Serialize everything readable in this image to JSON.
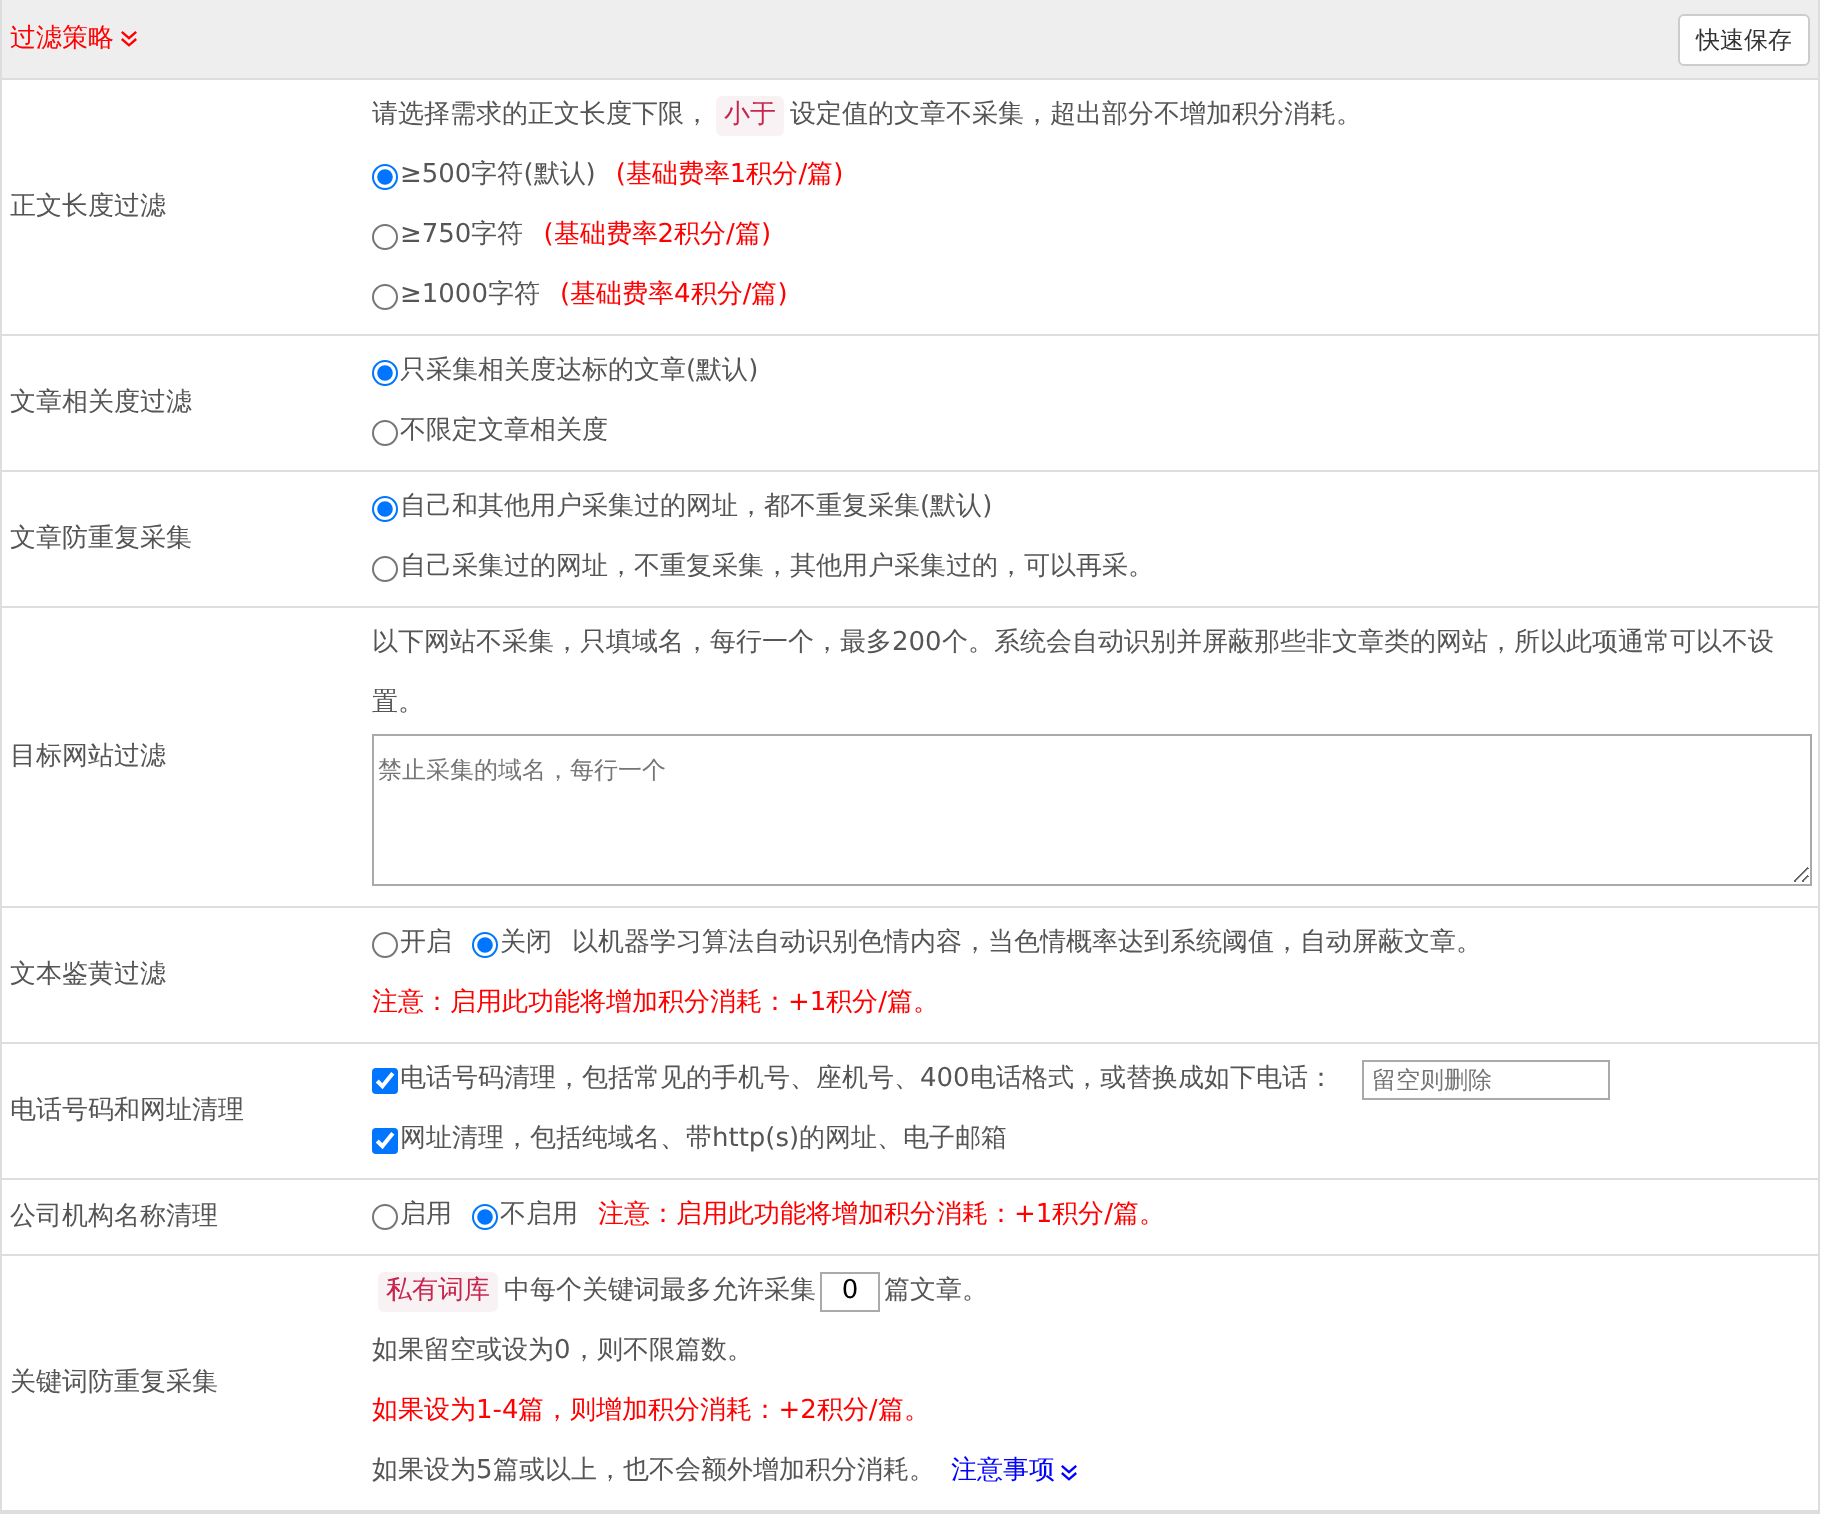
{
  "header": {
    "title": "过滤策略",
    "button": "快速保存"
  },
  "rows": [
    {
      "label": "正文长度过滤",
      "lines": [
        [
          {
            "kind": "text",
            "text": "请选择需求的正文长度下限，"
          },
          {
            "kind": "tag",
            "text": "小于"
          },
          {
            "kind": "text",
            "text": "设定值的文章不采集，超出部分不增加积分消耗。"
          }
        ],
        [
          {
            "kind": "radio",
            "label": "≥500字符(默认)",
            "selected": true
          },
          {
            "kind": "warn",
            "text": "(基础费率1积分/篇)"
          }
        ],
        [
          {
            "kind": "radio",
            "label": "≥750字符",
            "selected": false
          },
          {
            "kind": "warn",
            "text": "(基础费率2积分/篇)"
          }
        ],
        [
          {
            "kind": "radio",
            "label": "≥1000字符",
            "selected": false
          },
          {
            "kind": "warn",
            "text": "(基础费率4积分/篇)"
          }
        ]
      ]
    },
    {
      "label": "文章相关度过滤",
      "lines": [
        [
          {
            "kind": "radio",
            "label": "只采集相关度达标的文章(默认)",
            "selected": true
          }
        ],
        [
          {
            "kind": "radio",
            "label": "不限定文章相关度",
            "selected": false
          }
        ]
      ]
    },
    {
      "label": "文章防重复采集",
      "lines": [
        [
          {
            "kind": "radio",
            "label": "自己和其他用户采集过的网址，都不重复采集(默认)",
            "selected": true
          }
        ],
        [
          {
            "kind": "radio",
            "label": "自己采集过的网址，不重复采集，其他用户采集过的，可以再采。",
            "selected": false
          }
        ]
      ]
    },
    {
      "label": "目标网站过滤",
      "lines": [
        [
          {
            "kind": "text",
            "text": "以下网站不采集，只填域名，每行一个，最多200个。系统会自动识别并屏蔽那些非文章类的网站，所以此项通常可以不设置。"
          }
        ],
        [
          {
            "kind": "textarea",
            "placeholder": "禁止采集的域名，每行一个"
          }
        ]
      ]
    },
    {
      "label": "文本鉴黄过滤",
      "lines": [
        [
          {
            "kind": "radio",
            "label": "开启",
            "selected": false
          },
          {
            "kind": "radio",
            "label": "关闭",
            "selected": true
          },
          {
            "kind": "text",
            "text": "以机器学习算法自动识别色情内容，当色情概率达到系统阈值，自动屏蔽文章。"
          }
        ],
        [
          {
            "kind": "warn",
            "text": "注意：启用此功能将增加积分消耗：+1积分/篇。"
          }
        ]
      ]
    },
    {
      "label": "电话号码和网址清理",
      "lines": [
        [
          {
            "kind": "checkbox",
            "label": "电话号码清理，包括常见的手机号、座机号、400电话格式，或替换成如下电话：",
            "checked": true
          },
          {
            "kind": "input",
            "placeholder": "留空则删除"
          }
        ],
        [
          {
            "kind": "checkbox",
            "label": "网址清理，包括纯域名、带http(s)的网址、电子邮箱",
            "checked": true
          }
        ]
      ]
    },
    {
      "label": "公司机构名称清理",
      "lines": [
        [
          {
            "kind": "radio",
            "label": "启用",
            "selected": false
          },
          {
            "kind": "radio",
            "label": "不启用",
            "selected": true
          },
          {
            "kind": "warn",
            "text": "注意：启用此功能将增加积分消耗：+1积分/篇。"
          }
        ]
      ]
    },
    {
      "label": "关键词防重复采集",
      "lines": [
        [
          {
            "kind": "tag",
            "text": "私有词库"
          },
          {
            "kind": "text",
            "text": "中每个关键词最多允许采集"
          },
          {
            "kind": "number",
            "value": "0"
          },
          {
            "kind": "text",
            "text": "篇文章。"
          }
        ],
        [
          {
            "kind": "text",
            "text": "如果留空或设为0，则不限篇数。"
          }
        ],
        [
          {
            "kind": "warn",
            "text": "如果设为1-4篇，则增加积分消耗：+2积分/篇。"
          }
        ],
        [
          {
            "kind": "text",
            "text": "如果设为5篇或以上，也不会额外增加积分消耗。"
          },
          {
            "kind": "link",
            "text": "注意事项"
          }
        ]
      ]
    }
  ]
}
